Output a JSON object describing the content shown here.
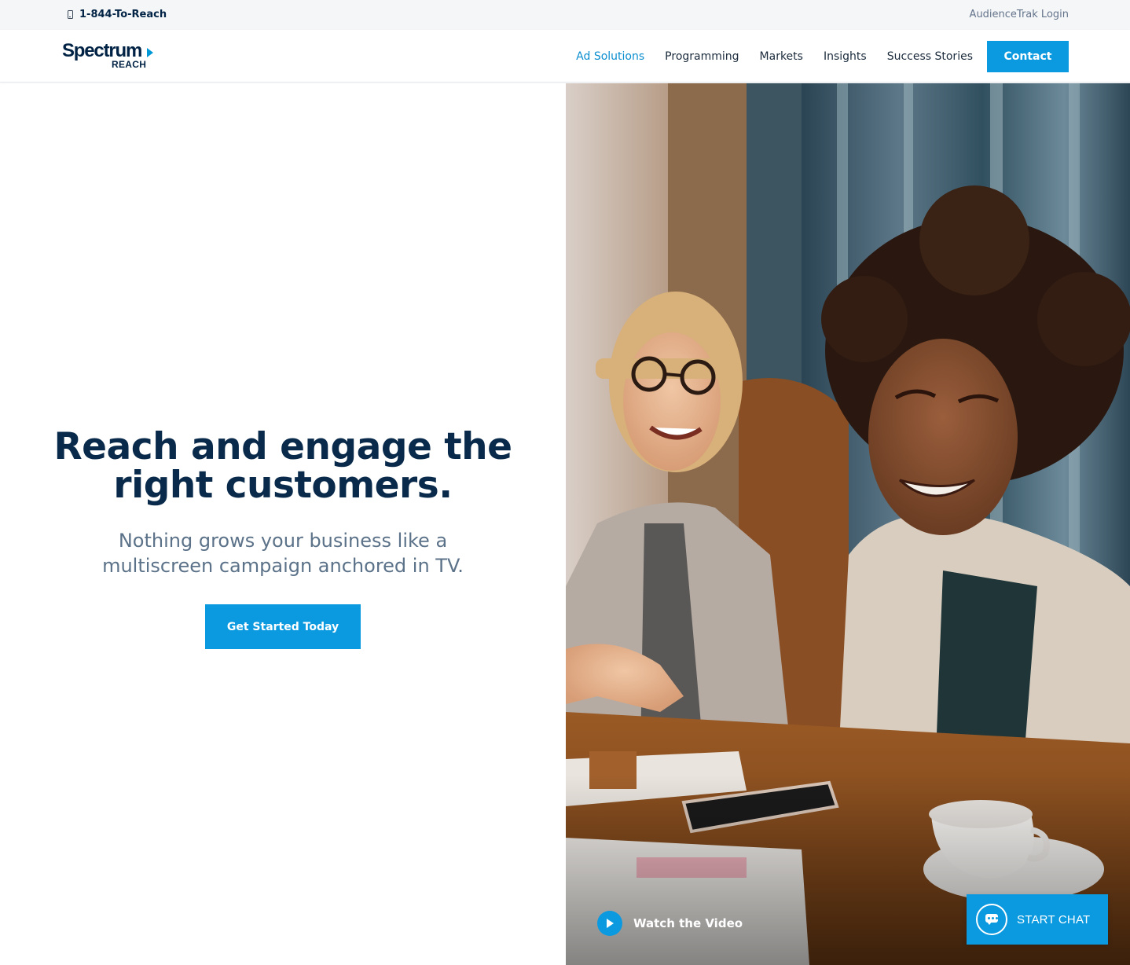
{
  "utility_bar": {
    "phone_icon": "mobile-phone-icon",
    "phone_label": "1-844-To-Reach",
    "login_label": "AudienceTrak Login"
  },
  "header": {
    "logo": {
      "wordmark": "Spectrum",
      "sub_wordmark": "REACH",
      "arrow_color": "#0099d8"
    },
    "nav": [
      {
        "label": "Ad Solutions",
        "active": true
      },
      {
        "label": "Programming",
        "active": false
      },
      {
        "label": "Markets",
        "active": false
      },
      {
        "label": "Insights",
        "active": false
      },
      {
        "label": "Success Stories",
        "active": false
      }
    ],
    "contact_label": "Contact"
  },
  "hero": {
    "title_line1": "Reach and engage the",
    "title_line2": "right customers.",
    "subtitle_line1": "Nothing grows your business like a",
    "subtitle_line2": "multiscreen campaign anchored in TV.",
    "cta_label": "Get Started Today"
  },
  "video": {
    "icon": "play-icon",
    "label": "Watch the Video"
  },
  "chat": {
    "icon": "chat-bubble-icon",
    "label": "START CHAT"
  },
  "colors": {
    "brand_navy": "#002244",
    "accent_blue": "#0b9ae0",
    "nav_active": "#0b8ed0",
    "subtitle_gray": "#5b7289",
    "utility_bg": "#f5f6f8"
  }
}
